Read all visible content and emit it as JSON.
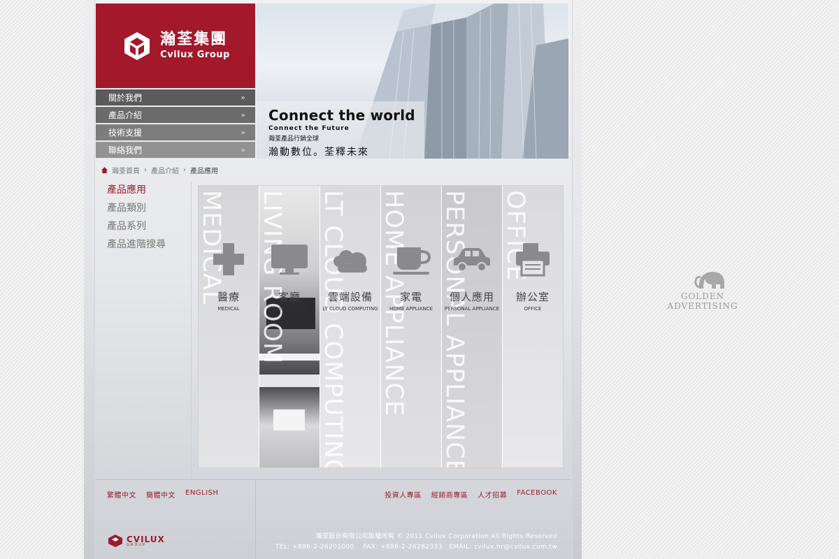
{
  "logo": {
    "cn": "瀚荃集團",
    "en": "Cvilux Group"
  },
  "nav": [
    {
      "label": "關於我們",
      "arrow": "»"
    },
    {
      "label": "產品介紹",
      "arrow": "»"
    },
    {
      "label": "技術支援",
      "arrow": "»"
    },
    {
      "label": "聯絡我們",
      "arrow": "»"
    }
  ],
  "banner": {
    "title": "Connect the world",
    "subtitle": "Connect the Future",
    "line1": "瀚荃產品行銷全球",
    "line2": "瀚動數位。荃釋未來"
  },
  "breadcrumb": {
    "home": "瀚荃首頁",
    "sep": "›",
    "level1": "產品介紹",
    "current": "產品應用"
  },
  "sidebar": {
    "items": [
      {
        "label": "產品應用"
      },
      {
        "label": "產品類別"
      },
      {
        "label": "產品系列"
      },
      {
        "label": "產品進階搜尋"
      }
    ]
  },
  "products": [
    {
      "vertical": "MEDICAL",
      "cn": "醫療",
      "en": "MEDICAL",
      "icon": "medical-cross-icon"
    },
    {
      "vertical": "LIVING ROOM",
      "cn": "客廳",
      "en": "LIVING ROOM",
      "icon": "monitor-icon"
    },
    {
      "vertical": "LT CLOUD COMPUTING",
      "cn": "雲端設備",
      "en": "LT CLOUD COMPUTING",
      "icon": "cloud-icon"
    },
    {
      "vertical": "HOME APPLIANCE",
      "cn": "家電",
      "en": "HOME APPLIANCE",
      "icon": "cup-icon"
    },
    {
      "vertical": "PERSONAL APPLIANCE",
      "cn": "個人應用",
      "en": "PERSONAL APPLIANCE",
      "icon": "car-icon"
    },
    {
      "vertical": "OFFICE",
      "cn": "辦公室",
      "en": "OFFICE",
      "icon": "printer-icon"
    }
  ],
  "footer": {
    "languages": [
      "繁體中文",
      "簡體中文",
      "ENGLISH"
    ],
    "links": [
      "投資人專區",
      "經銷商專區",
      "人才招募",
      "FACEBOOK"
    ],
    "logo_text": "CVILUX",
    "logo_sub": "GROUP",
    "copyright": "瀚荃股份有限公司版權所有 © 2011 Cvilux Corporation All Rights Reserved",
    "contact": "TEL: +886-2-26201000　 FAX: +886-2-26282333　EMAIL: cvilux.hr@cvilux.com.tw"
  },
  "watermark": {
    "text": "GOLDEN ADVERTISING"
  },
  "colors": {
    "brand_red": "#a3182a",
    "link_red": "#9b1c2c"
  }
}
